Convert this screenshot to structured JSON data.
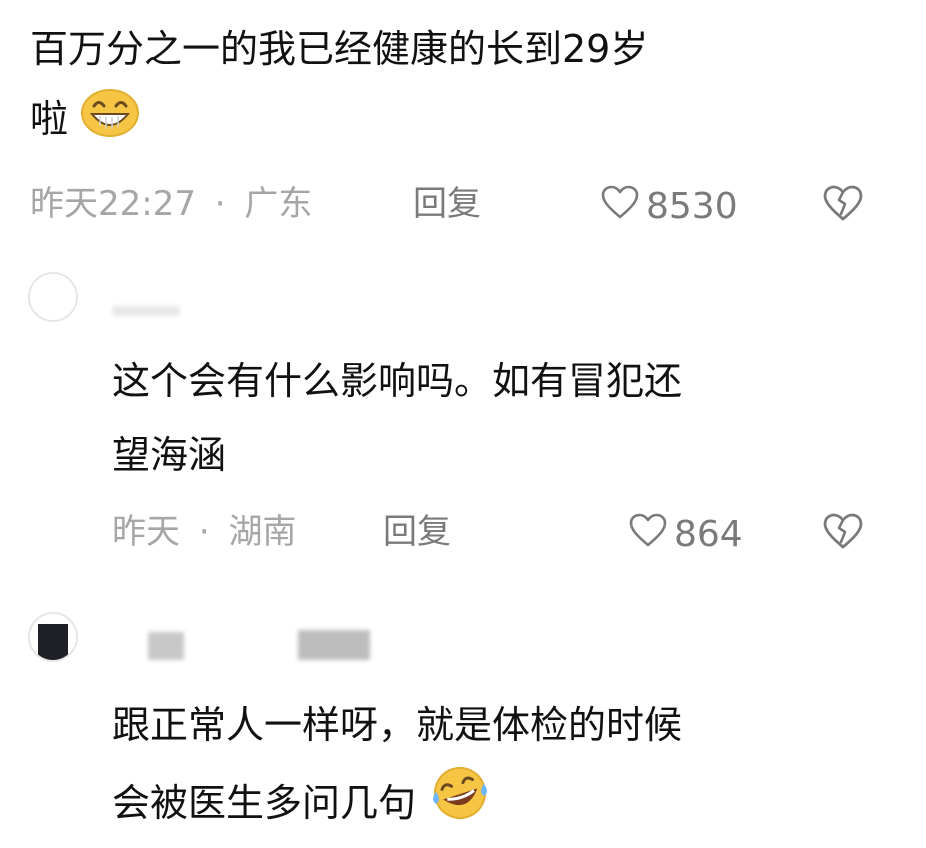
{
  "comments": [
    {
      "text_line1": "百万分之一的我已经健康的长到29岁",
      "text_line2": "啦",
      "emoji": "grinning-face-icon",
      "time": "昨天22:27",
      "separator": "·",
      "location": "广东",
      "reply_label": "回复",
      "likes": "8530"
    },
    {
      "text_line1": "这个会有什么影响吗。如有冒犯还",
      "text_line2": "望海涵",
      "time": "昨天",
      "separator": "·",
      "location": "湖南",
      "reply_label": "回复",
      "likes": "864"
    },
    {
      "text_line1": "跟正常人一样呀，就是体检的时候",
      "text_line2": "会被医生多问几句",
      "emoji": "rolling-laughing-face-icon"
    }
  ],
  "colors": {
    "text": "#111111",
    "meta": "#a6a6a6",
    "action": "#7a7a7a",
    "emoji_yellow": "#f7c544"
  }
}
